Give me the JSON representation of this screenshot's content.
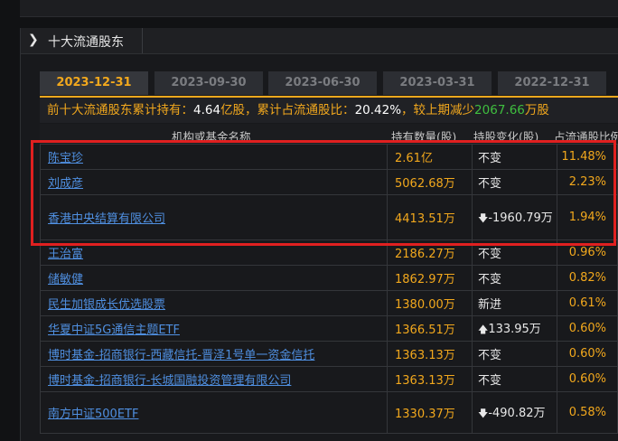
{
  "panel": {
    "title": "十大流通股东"
  },
  "tabs": [
    {
      "label": "2023-12-31",
      "active": true
    },
    {
      "label": "2023-09-30",
      "active": false
    },
    {
      "label": "2023-06-30",
      "active": false
    },
    {
      "label": "2023-03-31",
      "active": false
    },
    {
      "label": "2022-12-31",
      "active": false
    }
  ],
  "summary": {
    "prefix": "前十大流通股东累计持有：",
    "total": "4.64",
    "total_unit": "亿股，累计占流通股比：",
    "ratio": "20.42%",
    "mid": "，较上期减少",
    "change": "2067.66",
    "change_unit": "万股"
  },
  "columns": [
    "机构或基金名称",
    "持有数量(股)",
    "持股变化(股)",
    "占流通股比例"
  ],
  "rows": [
    {
      "name": "陈宝珍",
      "qty": "2.61亿",
      "change": "不变",
      "change_type": "same",
      "ratio": "11.48%"
    },
    {
      "name": "刘成彦",
      "qty": "5062.68万",
      "change": "不变",
      "change_type": "same",
      "ratio": "2.23%"
    },
    {
      "name": "香港中央结算有限公司",
      "qty": "4413.51万",
      "change": "-1960.79万",
      "change_type": "down",
      "ratio": "1.94%"
    },
    {
      "name": "王治富",
      "qty": "2186.27万",
      "change": "不变",
      "change_type": "same",
      "ratio": "0.96%"
    },
    {
      "name": "储敏健",
      "qty": "1862.97万",
      "change": "不变",
      "change_type": "same",
      "ratio": "0.82%"
    },
    {
      "name": "民生加银成长优选股票",
      "qty": "1380.00万",
      "change": "新进",
      "change_type": "new",
      "ratio": "0.61%"
    },
    {
      "name": "华夏中证5G通信主题ETF",
      "qty": "1366.51万",
      "change": "133.95万",
      "change_type": "up",
      "ratio": "0.60%"
    },
    {
      "name": "博时基金-招商银行-西藏信托-晋泽1号单一资金信托",
      "qty": "1363.13万",
      "change": "不变",
      "change_type": "same",
      "ratio": "0.60%"
    },
    {
      "name": "博时基金-招商银行-长城国融投资管理有限公司",
      "qty": "1363.13万",
      "change": "不变",
      "change_type": "same",
      "ratio": "0.60%"
    },
    {
      "name": "南方中证500ETF",
      "qty": "1330.37万",
      "change": "-490.82万",
      "change_type": "down",
      "ratio": "0.58%"
    }
  ],
  "colors": {
    "accent": "#f2a81d",
    "link": "#4f8fe0",
    "up": "#e83a3a",
    "down": "#3fbf3f",
    "highlight": "#e02020"
  },
  "icons": {
    "panel": "chevron-right-icon",
    "up": "arrow-up-icon",
    "down": "arrow-down-icon"
  }
}
